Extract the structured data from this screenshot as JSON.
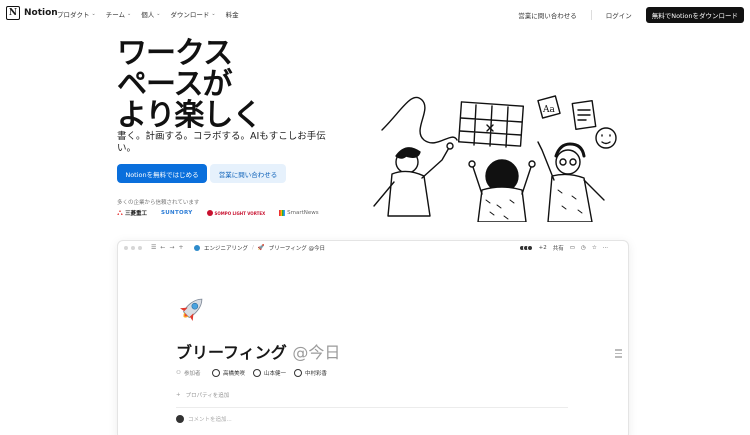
{
  "nav": {
    "logo_text": "Notion",
    "logo_mark": "N",
    "links": [
      {
        "label": "プロダクト",
        "dropdown": true
      },
      {
        "label": "チーム",
        "dropdown": true
      },
      {
        "label": "個人",
        "dropdown": true
      },
      {
        "label": "ダウンロード",
        "dropdown": true
      },
      {
        "label": "料金",
        "dropdown": false
      }
    ],
    "contact_sales": "営業に問い合わせる",
    "login": "ログイン",
    "cta": "無料でNotionをダウンロード"
  },
  "hero": {
    "title_lines": [
      "ワークス",
      "ペースが",
      "より楽しく"
    ],
    "subtitle": "書く。計画する。コラボする。AIもすこしお手伝い。",
    "primary_button": "Notionを無料ではじめる",
    "secondary_button": "営業に問い合わせる",
    "trusted_text": "多くの企業から信頼されています",
    "companies": [
      "三菱重工",
      "SUNTORY",
      "SOMPO LIGHT VORTEX",
      "SmartNews"
    ]
  },
  "app_window": {
    "breadcrumb": [
      "エンジニアリング",
      "ブリーフィング @今日"
    ],
    "collaborator_extra": "+2",
    "share_label": "共有",
    "page_icon": "rocket-icon",
    "page_title_main": "ブリーフィング",
    "page_title_date": "@今日",
    "attendees_label": "参加者",
    "attendees": [
      "高橋美咲",
      "山本健一",
      "中村彩香"
    ],
    "add_property": "プロパティを追加",
    "comment_placeholder": "コメントを追加..."
  },
  "colors": {
    "primary": "#0a6fdc",
    "secondary_bg": "#e6f1fc",
    "text": "#191919",
    "cta_bg": "#111111"
  }
}
